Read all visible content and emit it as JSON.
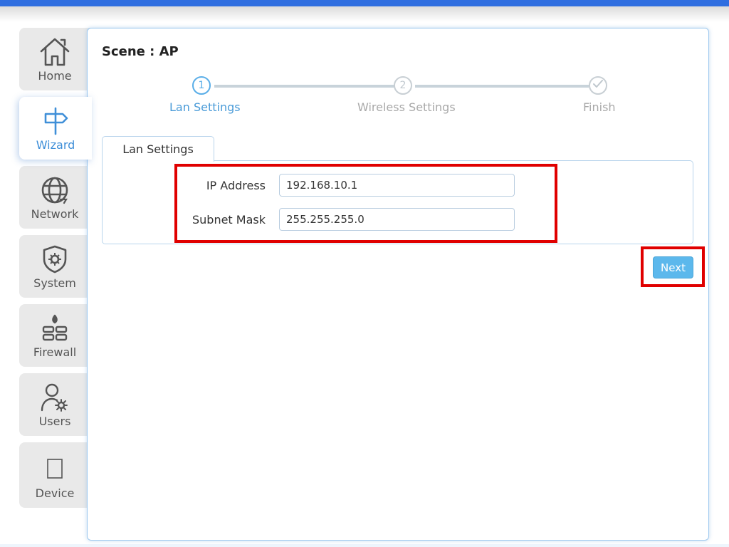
{
  "sidebar": {
    "items": [
      {
        "label": "Home",
        "icon": "home-icon"
      },
      {
        "label": "Wizard",
        "icon": "signpost-icon"
      },
      {
        "label": "Network",
        "icon": "globe-network-icon"
      },
      {
        "label": "System",
        "icon": "shield-gear-icon"
      },
      {
        "label": "Firewall",
        "icon": "firewall-icon"
      },
      {
        "label": "Users",
        "icon": "user-wrench-icon"
      },
      {
        "label": "Device",
        "icon": "device-icon"
      }
    ],
    "active": "Wizard"
  },
  "scene": {
    "title": "Scene : AP"
  },
  "steps": [
    {
      "number": "1",
      "label": "Lan Settings",
      "state": "active"
    },
    {
      "number": "2",
      "label": "Wireless Settings",
      "state": "pending"
    },
    {
      "number": "",
      "label": "Finish",
      "state": "pending",
      "icon": "check-icon"
    }
  ],
  "form": {
    "tab_label": "Lan Settings",
    "ip_address": {
      "label": "IP Address",
      "value": "192.168.10.1"
    },
    "subnet_mask": {
      "label": "Subnet Mask",
      "value": "255.255.255.0"
    }
  },
  "actions": {
    "next_label": "Next"
  },
  "colors": {
    "accent": "#3f8fd8",
    "highlight": "#e00000",
    "button": "#5cb8ec",
    "topbar": "#2f6ee0"
  }
}
